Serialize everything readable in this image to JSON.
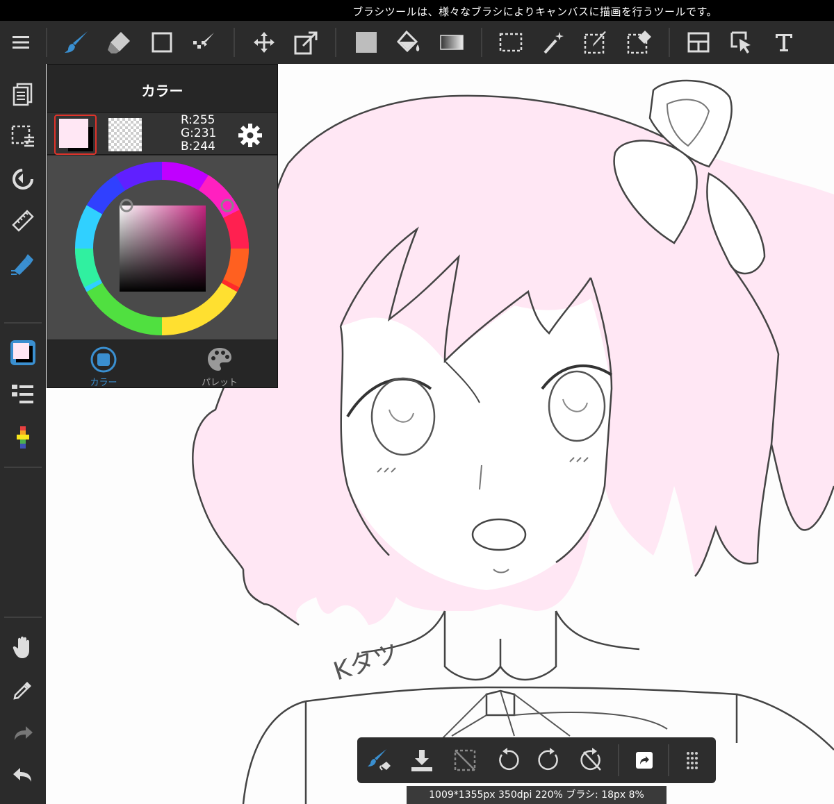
{
  "topbar": {
    "hint": "ブラシツールは、様々なブラシによりキャンバスに描画を行うツールです。"
  },
  "toolbar": {
    "items": [
      "menu-icon",
      "brush-icon",
      "eraser-icon",
      "rectangle-icon",
      "dot-brush-icon",
      "move-icon",
      "transform-icon",
      "fill-color-icon",
      "bucket-icon",
      "gradient-icon",
      "select-rect-icon",
      "magic-wand-icon",
      "select-pen-icon",
      "select-eraser-icon",
      "frame-icon",
      "operation-icon",
      "text-icon"
    ]
  },
  "colors": {
    "accent_blue": "#3a8fd0",
    "current_color": "#ffe7f4",
    "panel_bg": "#262626",
    "selection_red": "#e0332a"
  },
  "color_panel": {
    "title": "カラー",
    "rgb": {
      "r": "R:255",
      "g": "G:231",
      "b": "B:244"
    },
    "tabs": [
      {
        "label": "カラー",
        "active": true
      },
      {
        "label": "パレット",
        "active": false
      }
    ]
  },
  "signature": "Kタツ",
  "bottom_bar": {
    "items": [
      "brush-settings-icon",
      "download-icon",
      "deselect-icon",
      "rotate-left-icon",
      "rotate-right-icon",
      "reset-rotation-icon",
      "share-icon",
      "grid-icon"
    ]
  },
  "status": {
    "text": "1009*1355px 350dpi 220% ブラシ: 18px 8%"
  }
}
